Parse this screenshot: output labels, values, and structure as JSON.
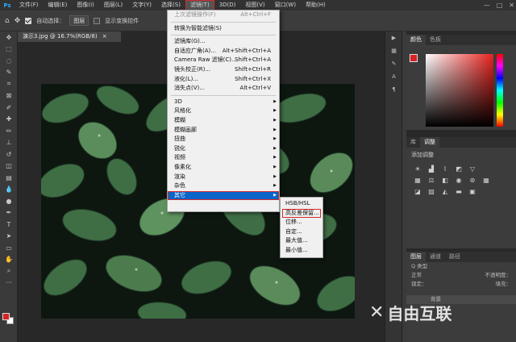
{
  "menubar": {
    "logo": "Ps",
    "items": [
      "文件(F)",
      "编辑(E)",
      "图像(I)",
      "图层(L)",
      "文字(Y)",
      "选择(S)",
      "滤镜(T)",
      "3D(D)",
      "视图(V)",
      "窗口(W)",
      "帮助(H)"
    ],
    "active_index": 6,
    "window_buttons": [
      "—",
      "□",
      "✕"
    ]
  },
  "options": {
    "auto_select_label": "自动选择：",
    "auto_select_value": "图层",
    "show_transform_label": "显示变换控件"
  },
  "document": {
    "tab_title": "演示3.jpg @ 16.7%(RGB/8)",
    "close": "×"
  },
  "filter_menu": {
    "items": [
      {
        "label": "上次滤镜操作(F)",
        "shortcut": "Alt+Ctrl+F",
        "disabled": true
      },
      {
        "sep": true
      },
      {
        "label": "转换为智能滤镜(S)"
      },
      {
        "sep": true
      },
      {
        "label": "滤镜库(G)..."
      },
      {
        "label": "自适应广角(A)...",
        "shortcut": "Alt+Shift+Ctrl+A"
      },
      {
        "label": "Camera Raw 滤镜(C)...",
        "shortcut": "Shift+Ctrl+A"
      },
      {
        "label": "镜头校正(R)...",
        "shortcut": "Shift+Ctrl+R"
      },
      {
        "label": "液化(L)...",
        "shortcut": "Shift+Ctrl+X"
      },
      {
        "label": "消失点(V)...",
        "shortcut": "Alt+Ctrl+V"
      },
      {
        "sep": true
      },
      {
        "label": "3D",
        "submenu": true
      },
      {
        "label": "风格化",
        "submenu": true
      },
      {
        "label": "模糊",
        "submenu": true
      },
      {
        "label": "模糊画廊",
        "submenu": true
      },
      {
        "label": "扭曲",
        "submenu": true
      },
      {
        "label": "锐化",
        "submenu": true
      },
      {
        "label": "视频",
        "submenu": true
      },
      {
        "label": "像素化",
        "submenu": true
      },
      {
        "label": "渲染",
        "submenu": true
      },
      {
        "label": "杂色",
        "submenu": true
      },
      {
        "label": "其它",
        "submenu": true,
        "highlighted": true
      }
    ]
  },
  "other_submenu": {
    "items": [
      {
        "label": "HSB/HSL"
      },
      {
        "label": "高反差保留...",
        "highlighted": true
      },
      {
        "label": "位移..."
      },
      {
        "label": "自定..."
      },
      {
        "label": "最大值..."
      },
      {
        "label": "最小值..."
      }
    ]
  },
  "panels": {
    "color_tabs": [
      "颜色",
      "色板"
    ],
    "adjust_tabs": [
      "库",
      "调整"
    ],
    "adjust_title": "添加调整",
    "layer_tabs": [
      "图层",
      "通道",
      "路径"
    ],
    "layer_kind": "Q 类型",
    "blend_mode": "正常",
    "opacity_label": "不透明度：",
    "lock_label": "锁定：",
    "fill_label": "填充：",
    "layer_name": "背景"
  },
  "watermark": {
    "text": "自由互联"
  },
  "colors": {
    "fg": "#d92323",
    "bg": "#ffffff",
    "accent": "#0a64c8"
  }
}
